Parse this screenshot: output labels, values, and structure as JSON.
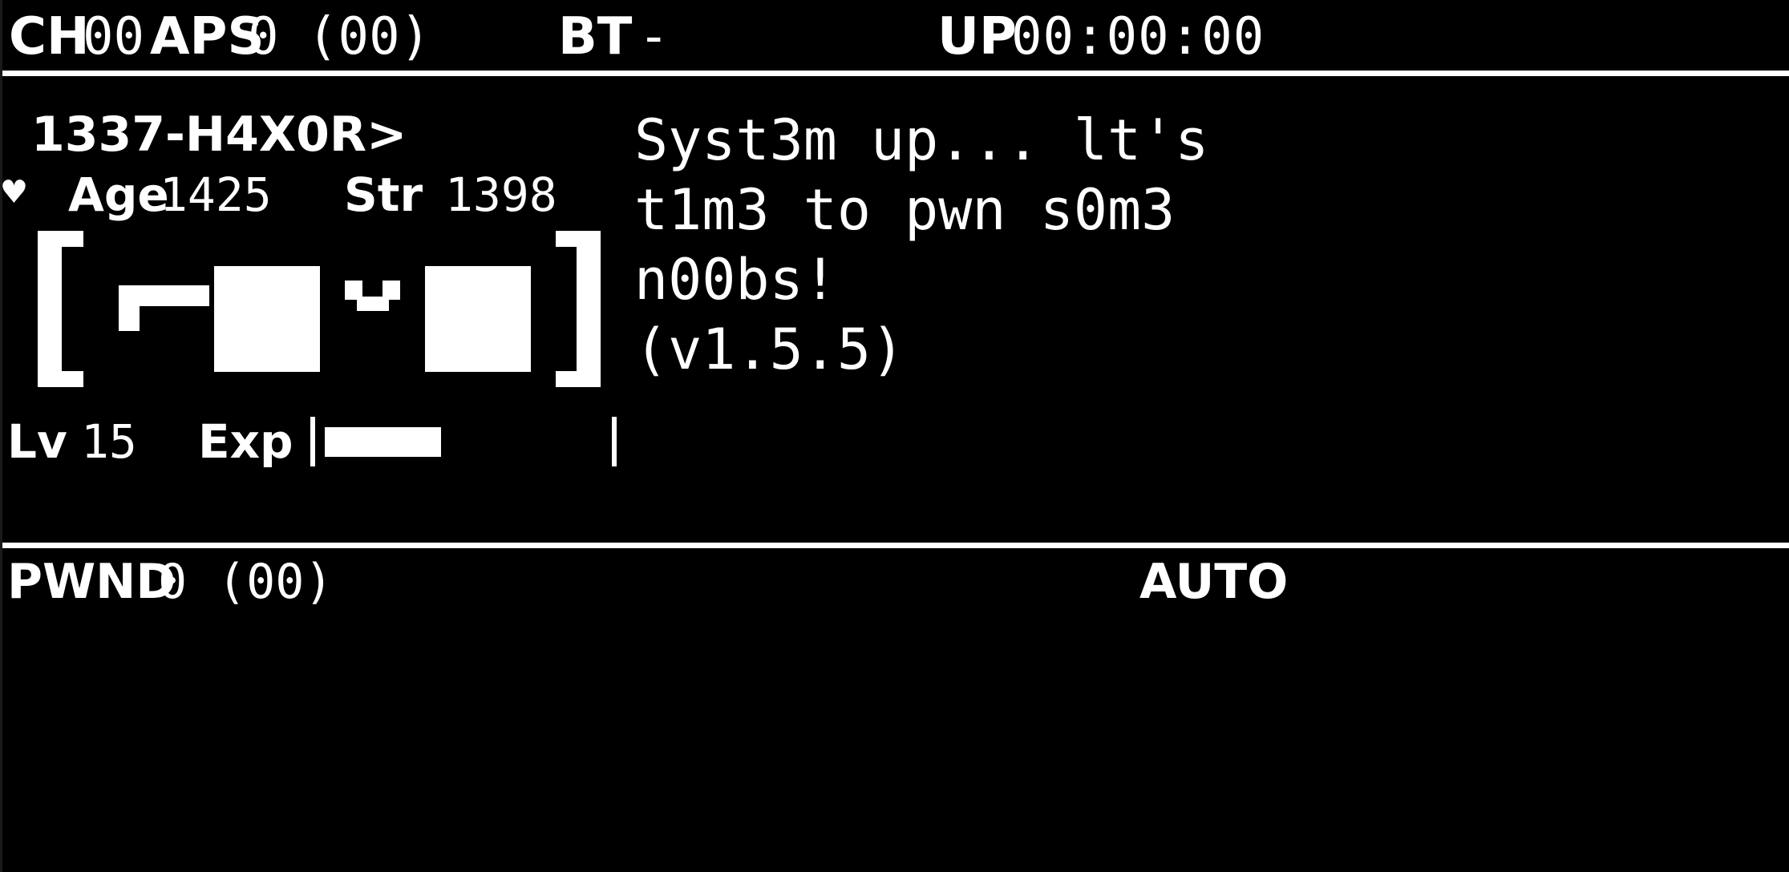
{
  "top_bar": {
    "ch_label": "CH",
    "ch_value": "00",
    "aps_label": "APS",
    "aps_value": "0",
    "aps_total": "(00)",
    "bt_label": "BT",
    "bt_value": "-",
    "up_label": "UP",
    "up_value": "00:00:00"
  },
  "main": {
    "name": "1337-H4X0R>",
    "age_label": "Age",
    "age_value": "1425",
    "str_label": "Str",
    "str_value": "1398",
    "face": "[ -■ ˅ ■ ]",
    "level_label": "Lv",
    "level_value": "15",
    "exp_label": "Exp",
    "exp_progress": 0.42,
    "status_lines": [
      "Syst3m up... lt's",
      "t1m3 to pwn s0m3",
      "n00bs!",
      "(v1.5.5)"
    ]
  },
  "bottom_bar": {
    "pwnd_label": "PWND",
    "pwnd_value": "0",
    "pwnd_total": "(00)",
    "mode": "AUTO"
  },
  "colors": {
    "background": "#000000",
    "foreground": "#ffffff"
  },
  "icons": {
    "heart": "heart-icon"
  }
}
